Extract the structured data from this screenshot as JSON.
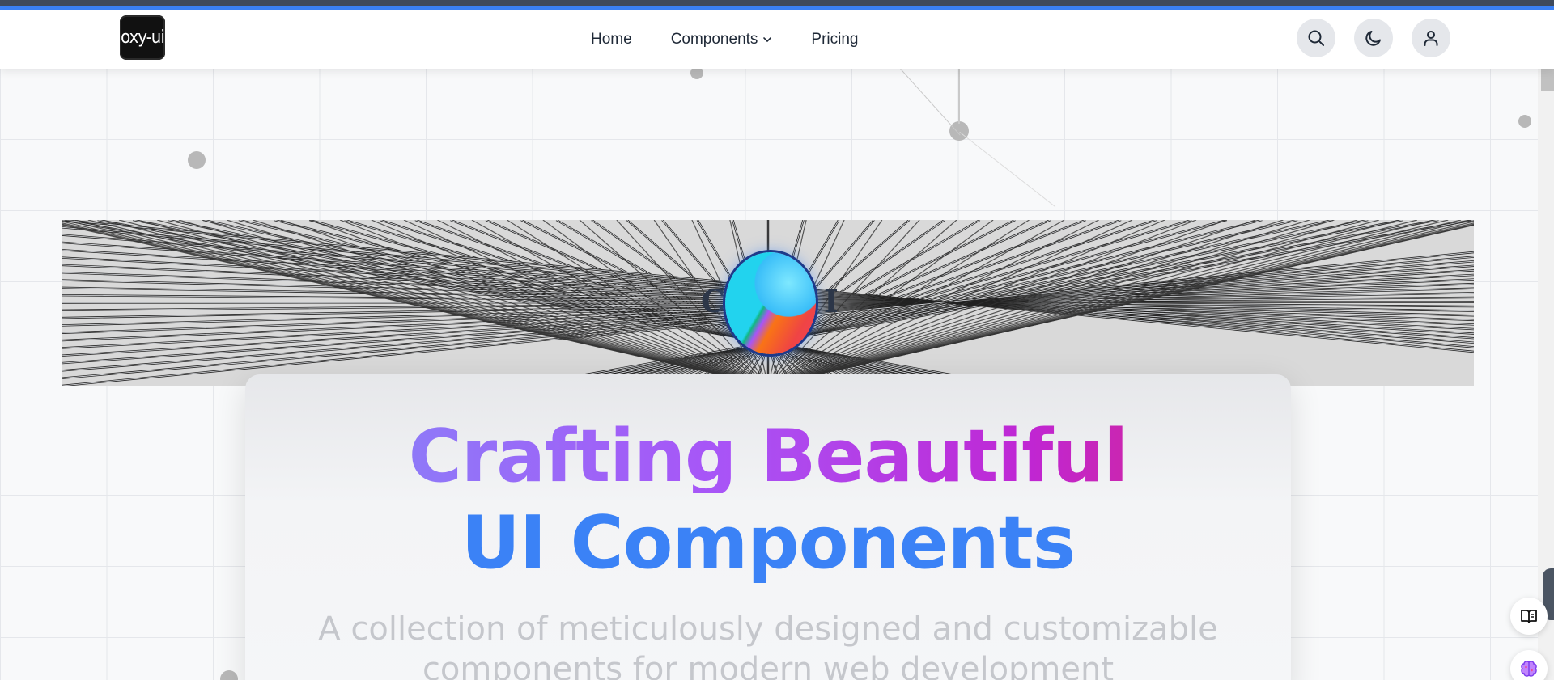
{
  "brand": {
    "logo_text": "oxy-ui",
    "logo_icon": "oxy-ui-logo"
  },
  "nav": {
    "items": [
      {
        "label": "Home"
      },
      {
        "label": "Components",
        "icon": "chevron-down-icon"
      },
      {
        "label": "Pricing"
      }
    ]
  },
  "actions": {
    "search_icon": "search-icon",
    "theme_icon": "moon-icon",
    "user_icon": "user-icon"
  },
  "hero": {
    "title_line1": "Crafting Beautiful",
    "title_line2": "UI Components",
    "subtitle_line1": "A collection of meticulously designed and customizable",
    "subtitle_line2": "components for modern web development"
  },
  "side_widgets": {
    "reader_icon": "book-open-icon",
    "ai_icon": "brain-icon"
  },
  "colors": {
    "accent": "#3b82f6",
    "gradient_start": "#818cf8",
    "gradient_mid": "#a855f7",
    "gradient_end": "#db2777",
    "top_bar": "#3f4a5c"
  }
}
